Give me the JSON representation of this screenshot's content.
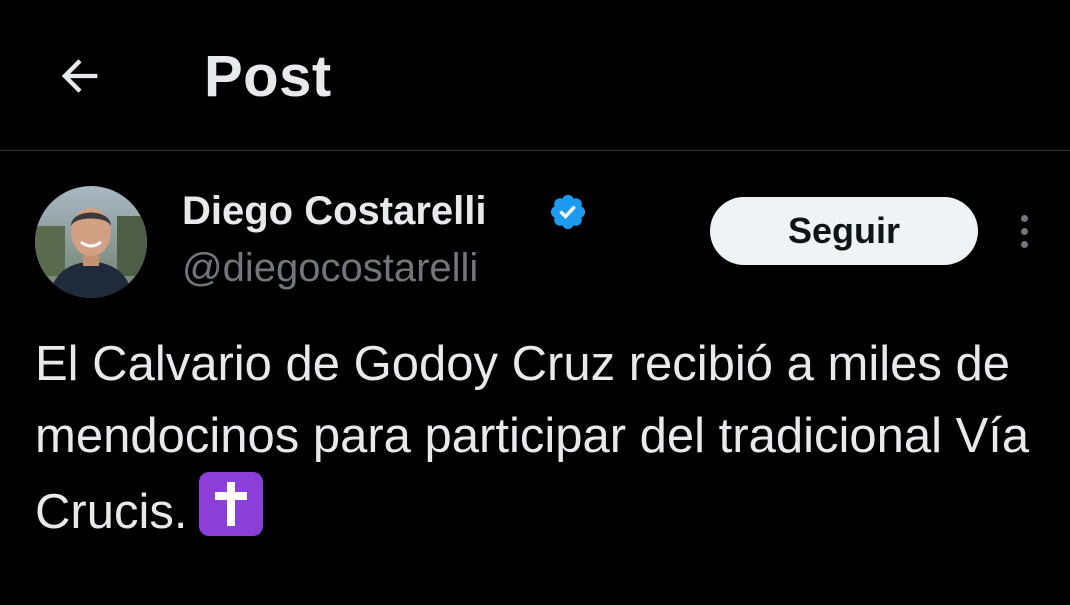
{
  "header": {
    "title": "Post",
    "back_icon": "arrow-left-icon"
  },
  "tweet": {
    "author": {
      "name": "Diego Costarelli",
      "handle": "@diegocostarelli",
      "verified": true,
      "verified_icon": "verified-badge-icon"
    },
    "follow_label": "Seguir",
    "more_icon": "vertical-dots-icon",
    "text": "El Calvario de Godoy Cruz recibió a miles de mendocinos para participar del tradicional Vía Crucis.",
    "emoji": "latin-cross-emoji"
  },
  "colors": {
    "background": "#000000",
    "text_primary": "#e7e9ea",
    "text_secondary": "#71767b",
    "divider": "#2f3336",
    "verified_blue": "#1d9bf0",
    "follow_bg": "#eff3f4",
    "emoji_purple": "#8b3fd8"
  }
}
